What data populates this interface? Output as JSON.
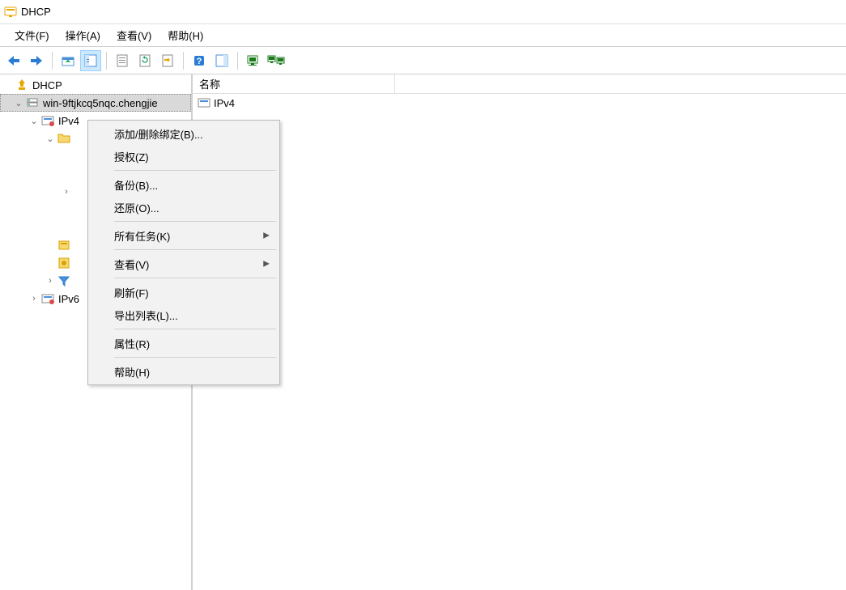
{
  "window": {
    "title": "DHCP"
  },
  "menu": {
    "file": "文件(F)",
    "action": "操作(A)",
    "view": "查看(V)",
    "help": "帮助(H)"
  },
  "tree": {
    "root": "DHCP",
    "server": "win-9ftjkcq5nqc.chengjie",
    "ipv4": "IPv4",
    "ipv6": "IPv6"
  },
  "list": {
    "header_name": "名称",
    "row1": "IPv4"
  },
  "context_menu": {
    "add_remove_binding": "添加/删除绑定(B)...",
    "authorize": "授权(Z)",
    "backup": "备份(B)...",
    "restore": "还原(O)...",
    "all_tasks": "所有任务(K)",
    "view": "查看(V)",
    "refresh": "刷新(F)",
    "export_list": "导出列表(L)...",
    "properties": "属性(R)",
    "help": "帮助(H)"
  }
}
